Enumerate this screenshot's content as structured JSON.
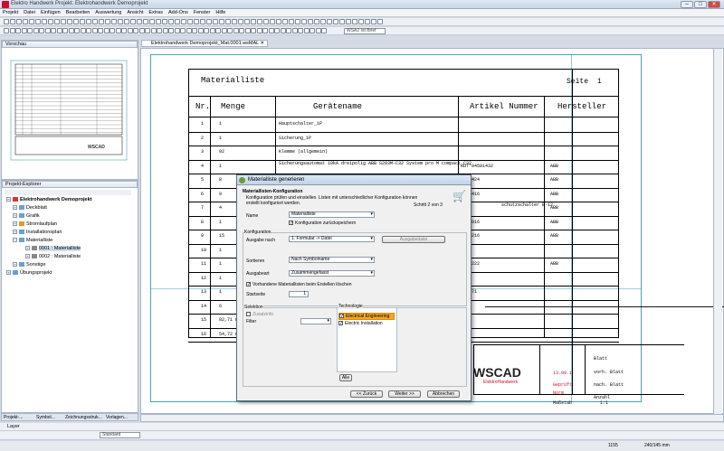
{
  "window": {
    "title": "Elektro Handwerk  Projekt: Elektrohandwerk Demoprojekt",
    "min": "–",
    "max": "□",
    "close": "✕"
  },
  "menu": [
    "Projekt",
    "Datei",
    "Einfügen",
    "Bearbeiten",
    "Auswertung",
    "Ansicht",
    "Extras",
    "Add-Ons",
    "Fenster",
    "Hilfe"
  ],
  "toolbar": {
    "combo1": "WSA2 Ist Brief",
    "combo2": ""
  },
  "preview": {
    "title": "Vorschau"
  },
  "explorer": {
    "title": "Projekt-Explorer",
    "root": "Elektrohandwerk Demoprojekt",
    "items": [
      "Deckblatt",
      "Grafik",
      "Stromlaufplan",
      "Installationsplan",
      "Materialliste",
      "0001 : Materialliste",
      "0002 : Materialliste",
      "Sonstige",
      "Übungsprojekt"
    ]
  },
  "bottom_tabs": [
    "Projekt-...",
    "Symbol...",
    "Zeichnungsstruk...",
    "Vorlagen..."
  ],
  "document": {
    "tab": "Elektrohandwerk Demoprojekt_Mat.0001.wsMAL",
    "title": "Materialliste",
    "seite_label": "Seite",
    "seite_num": "1",
    "col_nr": "Nr.",
    "col_menge": "Menge",
    "col_geraet": "Gerätename",
    "col_artikel": "Artikel Nummer",
    "col_hersteller": "Hersteller",
    "rows": [
      {
        "nr": "1",
        "menge": "1",
        "name": "Hauptschalter_1P",
        "art": "",
        "her": ""
      },
      {
        "nr": "2",
        "menge": "1",
        "name": "Sicherung_1P",
        "art": "",
        "her": ""
      },
      {
        "nr": "3",
        "menge": "92",
        "name": "Klemme (allgemein)",
        "art": "",
        "her": ""
      },
      {
        "nr": "4",
        "menge": "1",
        "name": "Sicherungsautomat 10kA dreipolig ABB S203M-C32 System pro M compact C32",
        "art": "RUT*04501432",
        "her": "ABB"
      },
      {
        "nr": "5",
        "menge": "8",
        "name": "",
        "art": "4501424",
        "her": "ABB"
      },
      {
        "nr": "6",
        "menge": "9",
        "name": "",
        "art": "4501416",
        "her": "ABB"
      },
      {
        "nr": "7",
        "menge": "4",
        "name": "",
        "art": "",
        "her": "ABB"
      },
      {
        "nr": "8",
        "menge": "1",
        "name": "",
        "art": "4500016",
        "her": "ABB"
      },
      {
        "nr": "9",
        "menge": "15",
        "name": "",
        "art": "4500216",
        "her": "ABB"
      },
      {
        "nr": "10",
        "menge": "1",
        "name": "",
        "art": "",
        "her": ""
      },
      {
        "nr": "11",
        "menge": "1",
        "name": "",
        "art": "4500222",
        "her": "ABB"
      },
      {
        "nr": "12",
        "menge": "1",
        "name": "",
        "art": "",
        "her": ""
      },
      {
        "nr": "13",
        "menge": "1",
        "name": "",
        "art": "415771",
        "her": ""
      },
      {
        "nr": "14",
        "menge": "6",
        "name": "",
        "art": "",
        "her": ""
      },
      {
        "nr": "15",
        "menge": "82,71 m",
        "name": "",
        "art": "",
        "her": ""
      },
      {
        "nr": "16",
        "menge": "54,72 m",
        "name": "",
        "art": "",
        "her": ""
      }
    ],
    "row7_extra": "schutzschalter B-12",
    "footer": {
      "date": "13.09.1",
      "gepr": "Geprüft",
      "norm": "Norm",
      "massstab": "Maßstab",
      "scale": "1:1",
      "blatt": "Blatt",
      "vorh": "vorh. Blatt",
      "nach": "nach. Blatt",
      "anzahl": "Anzahl",
      "logo": "WSCAD",
      "logo_sub": "ElektroHandwerk"
    }
  },
  "dialog": {
    "title": "Materialliste generieren",
    "heading": "Materiallisten-Konfiguration",
    "desc": "Konfiguration prüfen und einstellen. Listen mit unterschiedlicher Konfiguration können erstellt konfiguriert werden.",
    "step": "Schritt 2 von 3",
    "name_label": "Name",
    "name_value": "Materialliste",
    "save_config": "Konfiguration zurückspeichern",
    "konfig_label": "Konfiguration",
    "ausgabe_nach_label": "Ausgabe nach",
    "ausgabe_nach_value": "1. Formular -> Datei",
    "ausgabedatei_btn": "Ausgabedatei",
    "sortieren_label": "Sortieren",
    "sortieren_value": "Nach Symbolname",
    "ausgabeart_label": "Ausgabeart",
    "ausgabeart_value": "Zusammengefasst",
    "delete_existing": "Vorhandene Materiallisten beim Erstellen löschen",
    "startseite_label": "Startseite",
    "startseite_value": "1",
    "selektion_label": "Selektion",
    "zusatzinfo": "Zusatzinfo",
    "filter_label": "Filter",
    "technologie_label": "Technologie",
    "tech_items": [
      "Electrical Engineering",
      "Electric Installation"
    ],
    "alle_btn": "Alle",
    "back_btn": "<< Zurück",
    "next_btn": "Weiter >>",
    "cancel_btn": "Abbrechen"
  },
  "layer": {
    "label": "Layer",
    "standard": "Standard"
  },
  "status": {
    "coord": "1155",
    "scale": "240/145 mm"
  },
  "colors": {
    "accent": "#40a9b6",
    "highlight": "#f6a623",
    "logo_red": "#c8102e"
  }
}
